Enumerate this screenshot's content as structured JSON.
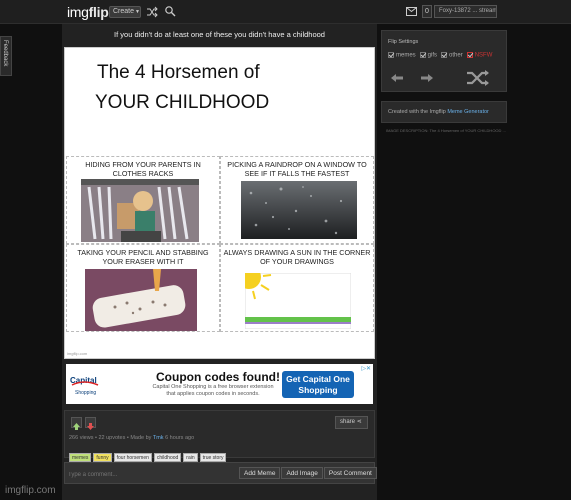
{
  "topbar": {
    "logo_img": "img",
    "logo_flip": "flip",
    "create_label": "Create",
    "notif_count": "0",
    "user_label": "Foxy-13872 ... streams"
  },
  "feedback_label": "Feedback",
  "post": {
    "title": "If you didn't do at least one of these you didn't have a childhood",
    "meme": {
      "title_line1": "The 4 Horsemen of",
      "title_line2": "YOUR CHILDHOOD",
      "panels": [
        {
          "caption": "HIDING FROM YOUR PARENTS IN CLOTHES RACKS"
        },
        {
          "caption": "PICKING A RAINDROP ON A WINDOW TO SEE IF IT FALLS THE FASTEST"
        },
        {
          "caption": "TAKING YOUR PENCIL AND STABBING YOUR ERASER WITH IT"
        },
        {
          "caption": "ALWAYS DRAWING A SUN IN THE CORNER OF YOUR DRAWINGS"
        }
      ],
      "watermark": "imgflip.com"
    },
    "ad": {
      "brand": "Capital One Shopping",
      "headline": "Coupon codes found!",
      "body": "Capital One Shopping is a free browser extension that applies coupon codes in seconds.",
      "cta": "Get Capital One Shopping",
      "info": "▷✕"
    },
    "actions": {
      "share_label": "share",
      "stats_prefix": "266 views • 22 upvotes • Made by ",
      "author": "Tmk",
      "stats_suffix": " 6 hours ago",
      "tags": [
        "memes",
        "funny",
        "four horsemen",
        "childhood",
        "rain",
        "true story"
      ]
    },
    "comment": {
      "placeholder": "Type a comment...",
      "buttons": [
        "Add Meme",
        "Add Image",
        "Post Comment"
      ]
    }
  },
  "sidebar": {
    "flip_settings_title": "Flip Settings",
    "options": [
      {
        "label": "memes",
        "checked": true
      },
      {
        "label": "gifs",
        "checked": true
      },
      {
        "label": "other",
        "checked": true
      },
      {
        "label": "NSFW",
        "checked": true
      }
    ],
    "created_prefix": "Created with the Imgflip ",
    "created_link": "Meme Generator",
    "footer": "IMAGE DESCRIPTION: The 4 Horsemen of YOUR CHILDHOOD ..."
  },
  "site_mark": "imgflip.com",
  "colors": {
    "background": "#101010",
    "panel": "#2a2a2a",
    "link": "#6ab0e8",
    "ad_cta": "#1464b4",
    "nsfw": "#cc3333"
  }
}
